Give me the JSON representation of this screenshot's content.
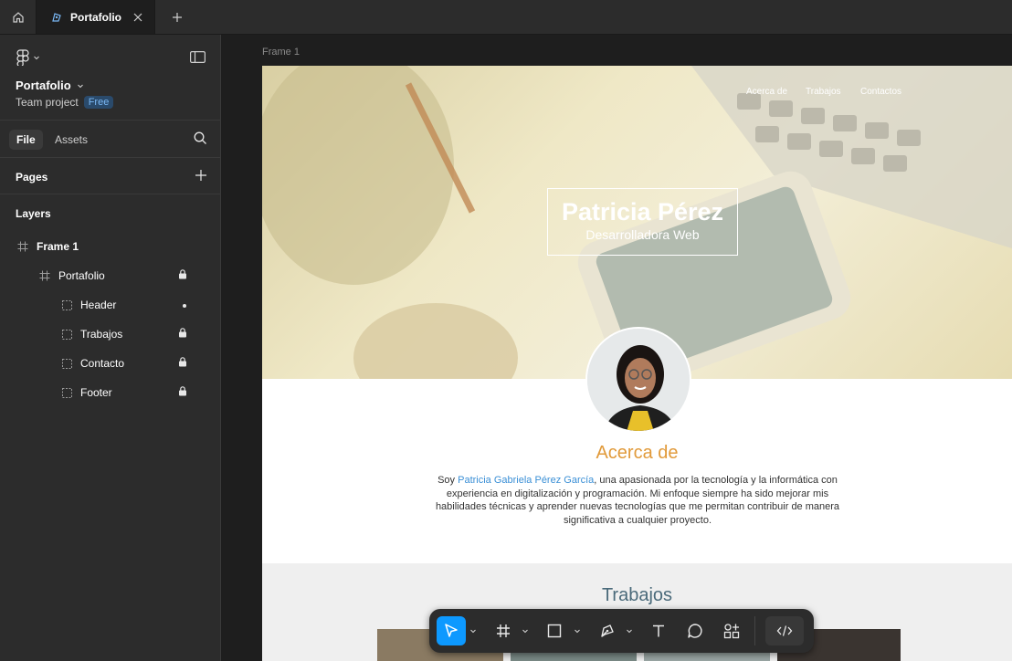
{
  "topbar": {
    "tab_title": "Portafolio"
  },
  "sidebar": {
    "project_name": "Portafolio",
    "team": "Team project",
    "plan_badge": "Free",
    "tabs": {
      "file": "File",
      "assets": "Assets"
    },
    "pages_title": "Pages",
    "layers_title": "Layers",
    "layers": [
      {
        "name": "Frame 1",
        "icon": "frame-icon",
        "locked": false
      },
      {
        "name": "Portafolio",
        "icon": "frame-icon",
        "locked": true
      },
      {
        "name": "Header",
        "icon": "section-icon",
        "locked": false
      },
      {
        "name": "Trabajos",
        "icon": "section-icon",
        "locked": true
      },
      {
        "name": "Contacto",
        "icon": "section-icon",
        "locked": true
      },
      {
        "name": "Footer",
        "icon": "section-icon",
        "locked": true
      }
    ]
  },
  "canvas": {
    "frame_label": "Frame 1",
    "nav": [
      "Acerca de",
      "Trabajos",
      "Contactos"
    ],
    "hero_name": "Patricia Pérez",
    "hero_subtitle": "Desarrolladora Web",
    "about_title": "Acerca de",
    "about_pre": "Soy ",
    "about_highlight": "Patricia Gabriela Pérez García",
    "about_post": ", una apasionada por la tecnología y la informática con experiencia en digitalización y programación. Mi enfoque siempre ha sido mejorar mis habilidades técnicas y aprender nuevas tecnologías que me permitan contribuir de manera significativa a cualquier proyecto.",
    "works_title": "Trabajos"
  },
  "colors": {
    "accent": "#0d99ff",
    "about_title": "#e19a3a",
    "highlight": "#3a8fd6"
  }
}
